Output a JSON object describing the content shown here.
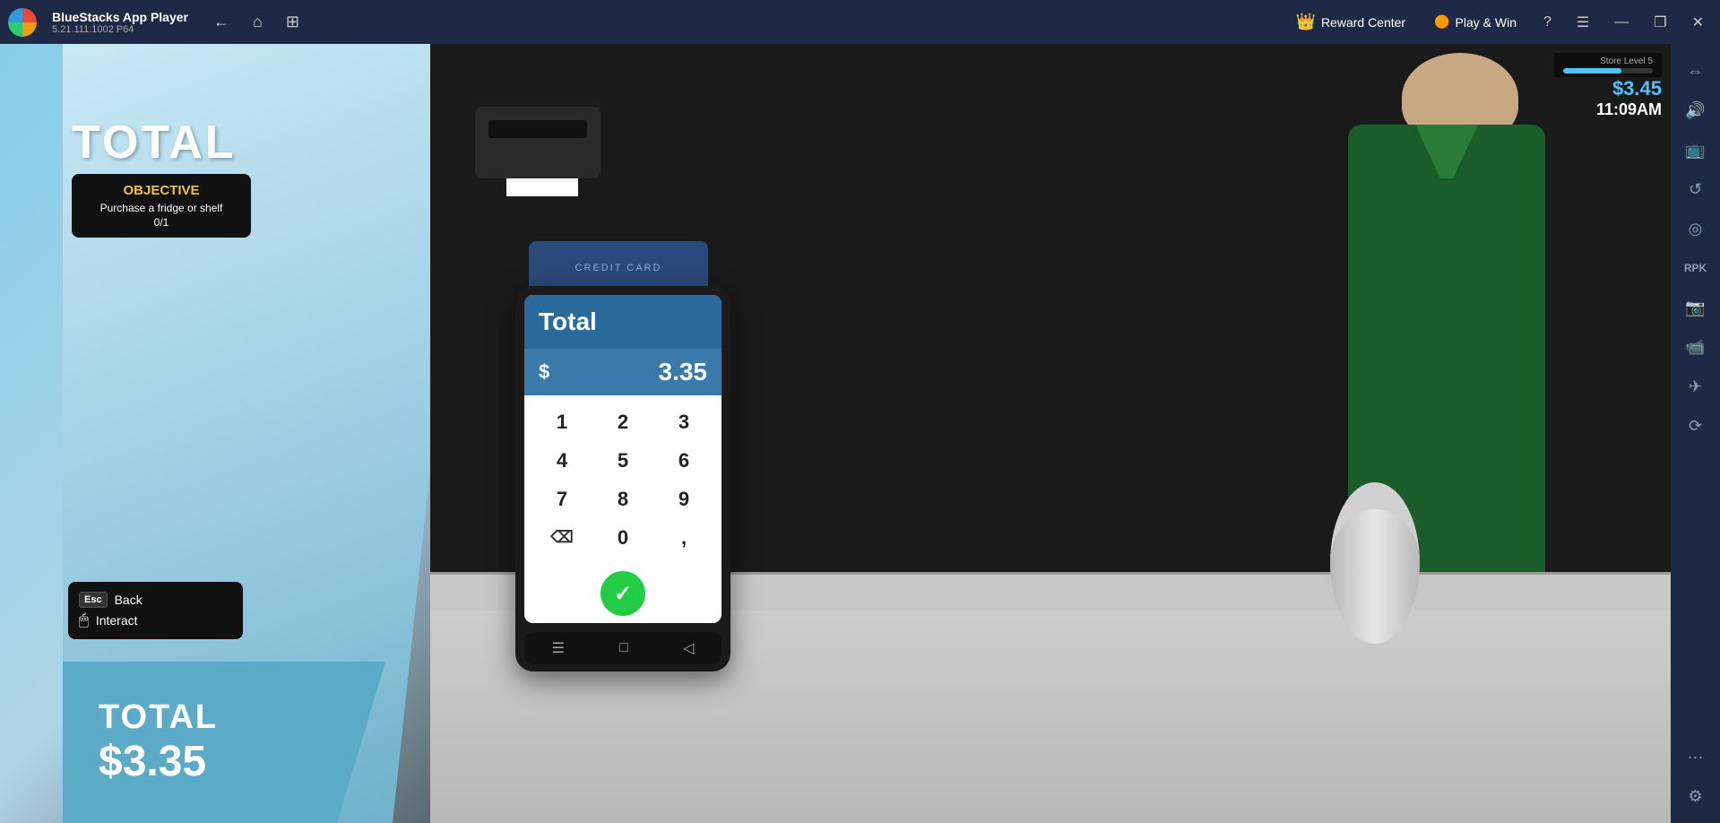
{
  "titlebar": {
    "app_name": "BlueStacks App Player",
    "app_version": "5.21.111.1002  P64",
    "nav": {
      "back": "←",
      "home": "⌂",
      "tabs": "⊞"
    },
    "reward_center": "Reward Center",
    "play_win": "Play & Win",
    "help": "?",
    "menu": "☰",
    "minimize": "—",
    "restore": "❐",
    "close": "✕"
  },
  "sidebar": {
    "icons": [
      "⊞",
      "📺",
      "▶",
      "↺",
      "⊙",
      "🔧",
      "📷",
      "📺",
      "✈",
      "⚙",
      "···"
    ]
  },
  "game": {
    "total_label_left": "TOTAL",
    "objective": {
      "title": "OBJECTIVE",
      "description": "Purchase a fridge or shelf",
      "progress": "0/1"
    },
    "controls": {
      "back_key": "Esc",
      "back_label": "Back",
      "interact_key": "🖱",
      "interact_label": "Interact"
    },
    "hud": {
      "store_level": "Store Level 5",
      "money": "$3.45",
      "time": "11:09AM"
    },
    "total_bottom_label": "TOTAL",
    "total_bottom_amount": "$3.35",
    "card_reader_text": "CREDIT CARD",
    "pos": {
      "header": "Total",
      "dollar_sign": "$",
      "amount": "3.35",
      "keys": [
        "1",
        "2",
        "3",
        "4",
        "5",
        "6",
        "7",
        "8",
        "9",
        "⌫",
        "0",
        ","
      ],
      "confirm_icon": "✓"
    }
  }
}
